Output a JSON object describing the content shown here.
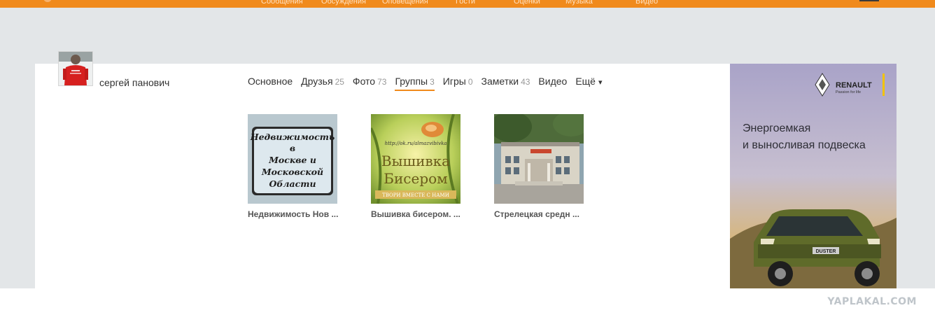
{
  "top_nav": {
    "items": [
      "Сообщения",
      "Обсуждения",
      "Оповещения",
      "Гости",
      "Оценки",
      "Музыка",
      "Видео"
    ]
  },
  "profile": {
    "name": "сергей панович"
  },
  "tabs": [
    {
      "label": "Основное",
      "count": ""
    },
    {
      "label": "Друзья",
      "count": "25"
    },
    {
      "label": "Фото",
      "count": "73"
    },
    {
      "label": "Группы",
      "count": "3",
      "active": true
    },
    {
      "label": "Игры",
      "count": "0"
    },
    {
      "label": "Заметки",
      "count": "43"
    },
    {
      "label": "Видео",
      "count": ""
    },
    {
      "label": "Ещё",
      "count": "",
      "arrow": "▾"
    }
  ],
  "groups": [
    {
      "title": "Недвижимость Нов ...",
      "thumb_text": [
        "Недвижимость",
        "в",
        "Москве и",
        "Московской",
        "Области"
      ]
    },
    {
      "title": "Вышивка бисером. ...",
      "thumb_url_text": "http://ok.ru/almazvibivka",
      "thumb_big_text": [
        "Вышивка",
        "Бисером"
      ],
      "thumb_banner": "ТВОРИ ВМЕСТЕ С НАМИ"
    },
    {
      "title": "Стрелецкая средн ..."
    }
  ],
  "ad": {
    "brand": "RENAULT",
    "tagline": "Passion for life",
    "headline_line1": "Энергоемкая",
    "headline_line2": "и выносливая подвеска",
    "plate": "DUSTER"
  },
  "watermark": "YAPLAKAL.COM"
}
